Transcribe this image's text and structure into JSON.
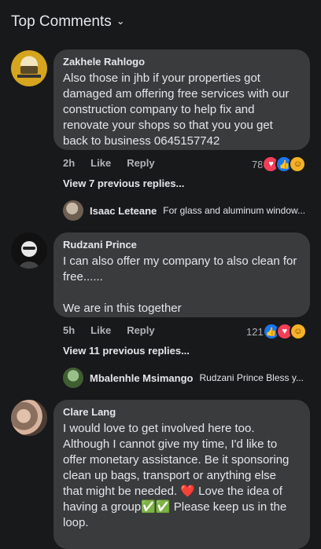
{
  "header": {
    "title": "Top Comments",
    "chevron": "chevron-down-icon"
  },
  "comments": [
    {
      "author": "Zakhele Rahlogo",
      "text": "Also those in jhb if your properties got damaged am offering free services with our construction company to help fix and renovate your shops so that you you get back to business  0645157742",
      "time": "2h",
      "like_label": "Like",
      "reply_label": "Reply",
      "reaction_count": "78",
      "view_replies": "View 7 previous replies...",
      "latest_reply": {
        "author": "Isaac Leteane",
        "text": "For glass and aluminum window..."
      }
    },
    {
      "author": "Rudzani Prince",
      "text": "I can also offer my company to also clean for free......\n\nWe are in this together",
      "time": "5h",
      "like_label": "Like",
      "reply_label": "Reply",
      "reaction_count": "121",
      "view_replies": "View 11 previous replies...",
      "latest_reply": {
        "author": "Mbalenhle Msimango",
        "text": "Rudzani Prince  Bless y..."
      }
    },
    {
      "author": "Clare Lang",
      "text": "I would love to get involved here too. Although I cannot give my time, I'd like to offer monetary assistance. Be it sponsoring clean up bags, transport or anything else that might be needed. ❤️ Love the idea of having a group✅✅ Please keep us in the loop."
    }
  ],
  "colors": {
    "bg": "#18191a",
    "bubble": "#3a3b3c",
    "like": "#1877f2",
    "love": "#f33e58",
    "care": "#f7b125"
  }
}
